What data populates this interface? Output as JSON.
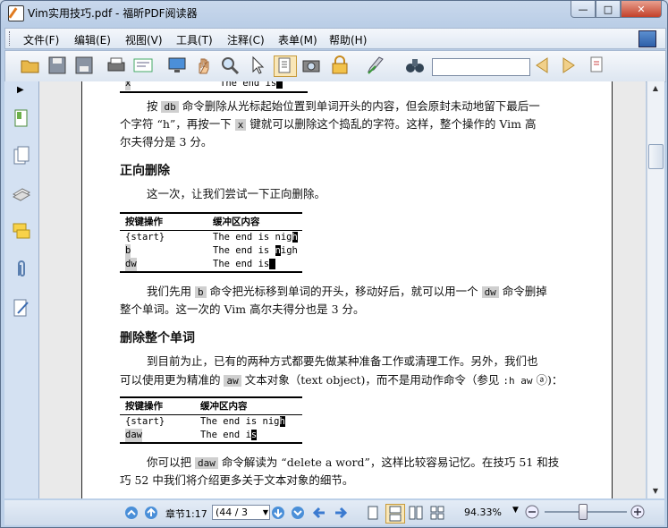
{
  "window": {
    "title": "Vim实用技巧.pdf - 福昕PDF阅读器"
  },
  "menu": [
    "文件(F)",
    "编辑(E)",
    "视图(V)",
    "工具(T)",
    "注释(C)",
    "表单(M)",
    "帮助(H)"
  ],
  "toolbar": {
    "search_value": ""
  },
  "doc": {
    "top_row": {
      "key": "x",
      "buffer": "The end is"
    },
    "para1": [
      "按 ",
      "db",
      " 命令删除从光标起始位置到单词开头的内容，但会原封未动地留下最后一",
      "个字符 “h”，再按一下 ",
      "x",
      " 键就可以删除这个捣乱的字符。这样，整个操作的 Vim 高",
      "尔夫得分是 3 分。"
    ],
    "h_forward": "正向删除",
    "para2": "这一次，让我们尝试一下正向删除。",
    "table1": {
      "headers": [
        "按键操作",
        "缓冲区内容"
      ],
      "rows": [
        {
          "key": "{start}",
          "pre": "The end is nig",
          "cur": "h",
          "post": ""
        },
        {
          "key": "b",
          "pre": "The end is ",
          "cur": "n",
          "post": "igh"
        },
        {
          "key": "dw",
          "pre": "The end is",
          "cur": " ",
          "post": ""
        }
      ]
    },
    "para3": [
      "我们先用 ",
      "b",
      " 命令把光标移到单词的开头，移动好后，就可以用一个 ",
      "dw",
      " 命令删掉",
      "整个单词。这一次的 Vim 高尔夫得分也是 3 分。"
    ],
    "h_word": "删除整个单词",
    "para4": [
      "到目前为止，已有的两种方式都要先做某种准备工作或清理工作。另外，我们也",
      "可以使用更为精准的 ",
      "aw",
      " 文本对象（text object)，而不是用动作命令（参见 ",
      ":h aw",
      " ⓐ)："
    ],
    "table2": {
      "headers": [
        "按键操作",
        "缓冲区内容"
      ],
      "rows": [
        {
          "key": "{start}",
          "pre": "The end is nig",
          "cur": "h",
          "post": ""
        },
        {
          "key": "daw",
          "pre": "The end i",
          "cur": "s",
          "post": ""
        }
      ]
    },
    "para5": [
      "你可以把 ",
      "daw",
      " 命令解读为 “delete a word”，这样比较容易记忆。在技巧 51 和技",
      "巧 52 中我们将介绍更多关于文本对象的细节。"
    ]
  },
  "status": {
    "chapter": "章节1:17",
    "page": "(44 / 3",
    "zoom": "94.33%"
  }
}
